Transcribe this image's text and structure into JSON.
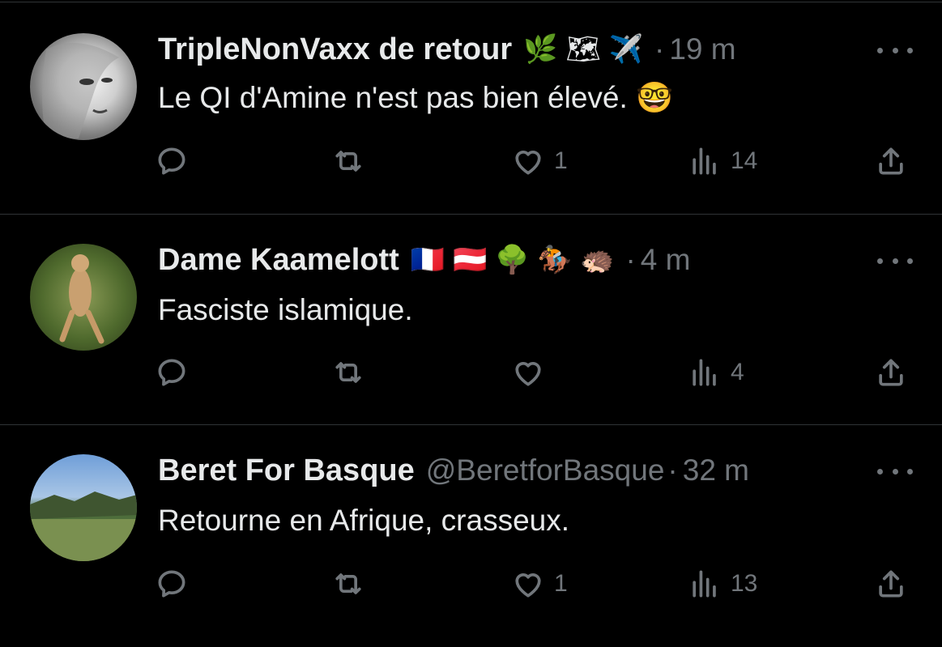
{
  "tweets": [
    {
      "name": "TripleNonVaxx de retour",
      "name_emojis": "🌿🗺✈️",
      "handle": "",
      "time": "19 m",
      "text": "Le QI d'Amine n'est pas bien élevé. 🤓",
      "likes": "1",
      "views": "14"
    },
    {
      "name": "Dame Kaamelott",
      "name_emojis": "🇫🇷🇦🇹🌳🏇🦔",
      "handle": "",
      "time": "4 m",
      "text": "Fasciste islamique.",
      "likes": "",
      "views": "4"
    },
    {
      "name": "Beret For Basque",
      "name_emojis": "",
      "handle": "@BeretforBasque",
      "time": "32 m",
      "text": "Retourne en Afrique, crasseux.",
      "likes": "1",
      "views": "13"
    }
  ],
  "separator": "·",
  "colors": {
    "background": "#000000",
    "text": "#e7e9ea",
    "muted": "#71767b",
    "divider": "#2f3336"
  },
  "icons": [
    "reply-icon",
    "retweet-icon",
    "like-icon",
    "views-icon",
    "share-icon",
    "more-icon"
  ]
}
